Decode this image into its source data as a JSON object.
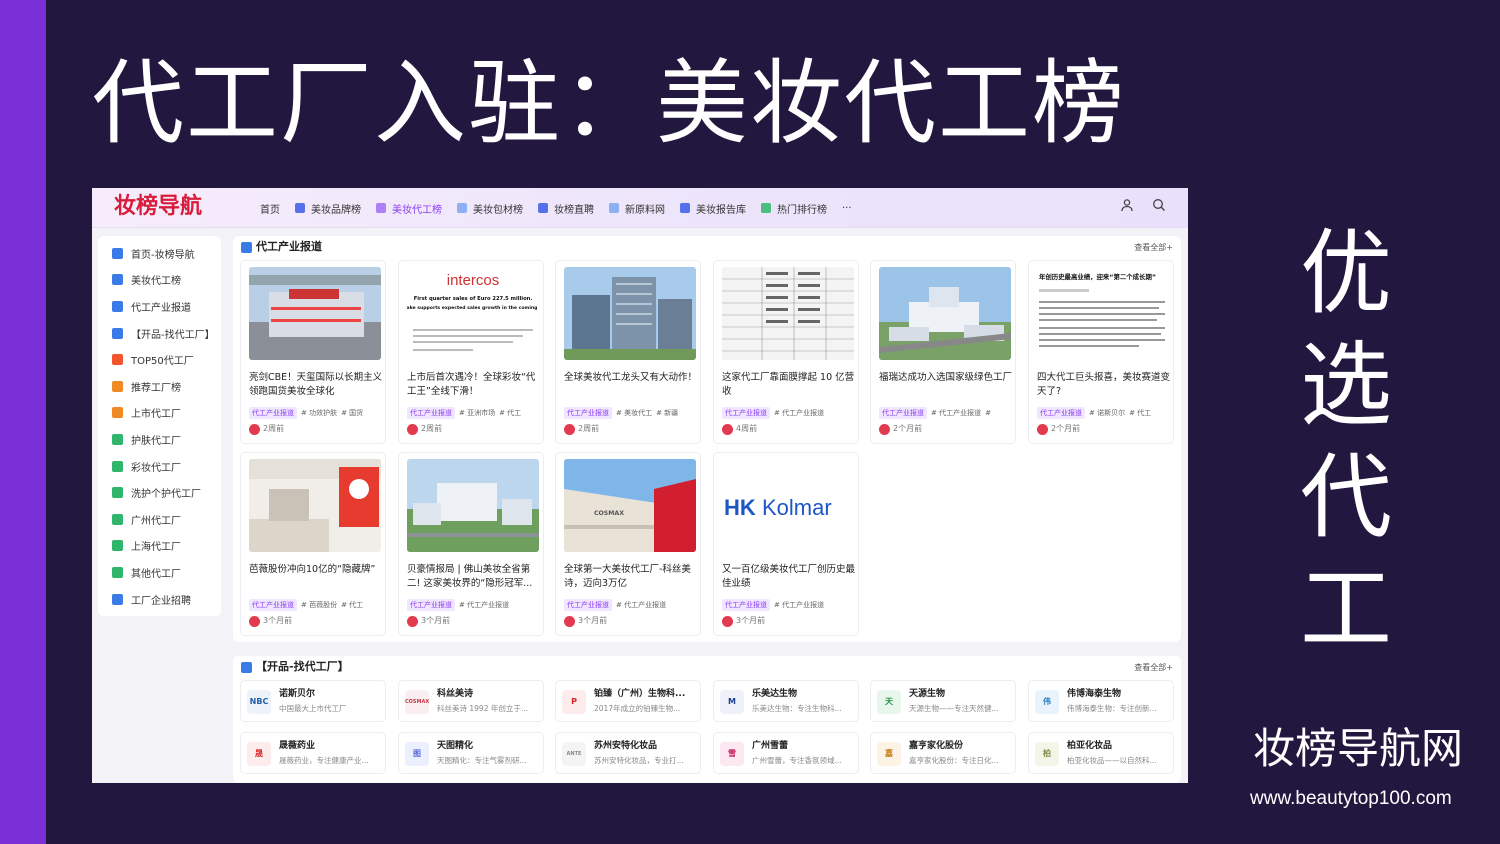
{
  "headline": "代工厂入驻：美妆代工榜",
  "vertical_text": [
    "优",
    "选",
    "代",
    "工"
  ],
  "brand": "妆榜导航网",
  "url": "www.beautytop100.com",
  "site": {
    "logo": "妆榜导航",
    "nav": [
      {
        "label": "首页",
        "icon": "none"
      },
      {
        "label": "美妆品牌榜",
        "icon": "bookmark-icon"
      },
      {
        "label": "美妆代工榜",
        "icon": "home-icon",
        "active": true
      },
      {
        "label": "美妆包材榜",
        "icon": "home-icon"
      },
      {
        "label": "妆榜直聘",
        "icon": "flag-icon"
      },
      {
        "label": "新原料网",
        "icon": "chat-icon"
      },
      {
        "label": "美妆报告库",
        "icon": "report-icon"
      },
      {
        "label": "热门排行榜",
        "icon": "bar-chart-icon"
      },
      {
        "label": "···",
        "icon": "none"
      }
    ],
    "sidebar": [
      {
        "label": "首页-妆榜导航",
        "icon": "home-icon",
        "color": "#3b7be8"
      },
      {
        "label": "美妆代工榜",
        "icon": "grid-icon",
        "color": "#3b7be8"
      },
      {
        "label": "代工产业报道",
        "icon": "news-icon",
        "color": "#3b7be8"
      },
      {
        "label": "【开品-找代工厂】",
        "icon": "grid-icon",
        "color": "#3b7be8"
      },
      {
        "label": "TOP50代工厂",
        "icon": "fire-icon",
        "color": "#f2542d"
      },
      {
        "label": "推荐工厂榜",
        "icon": "bookmark-icon",
        "color": "#f08a24"
      },
      {
        "label": "上市代工厂",
        "icon": "bookmark-icon",
        "color": "#f08a24"
      },
      {
        "label": "护肤代工厂",
        "icon": "apps-icon",
        "color": "#2fb66a"
      },
      {
        "label": "彩妆代工厂",
        "icon": "apps-icon",
        "color": "#2fb66a"
      },
      {
        "label": "洗护个护代工厂",
        "icon": "apps-icon",
        "color": "#2fb66a"
      },
      {
        "label": "广州代工厂",
        "icon": "apps-icon",
        "color": "#2fb66a"
      },
      {
        "label": "上海代工厂",
        "icon": "apps-icon",
        "color": "#2fb66a"
      },
      {
        "label": "其他代工厂",
        "icon": "apps-icon",
        "color": "#2fb66a"
      },
      {
        "label": "工厂企业招聘",
        "icon": "flag-icon",
        "color": "#3b7be8"
      }
    ],
    "news_section": {
      "title": "代工产业报道",
      "view_all": "查看全部+",
      "cards": [
        {
          "title": "亮剑CBE！天玺国际以长期主义领跑国货美妆全球化",
          "tags": [
            "代工产业报道",
            "# 功效护肤",
            "# 国货"
          ],
          "time": "2周前"
        },
        {
          "title": "上市后首次遇冷！全球彩妆“代工王”全线下滑！",
          "tags": [
            "代工产业报道",
            "# 亚洲市场",
            "# 代工"
          ],
          "time": "2周前"
        },
        {
          "title": "全球美妆代工龙头又有大动作！",
          "tags": [
            "代工产业报道",
            "# 美妆代工",
            "# 新疆"
          ],
          "time": "2周前"
        },
        {
          "title": "这家代工厂靠面膜撑起 10 亿营收",
          "tags": [
            "代工产业报道",
            "# 代工产业报道"
          ],
          "time": "4周前"
        },
        {
          "title": "福瑞达成功入选国家级绿色工厂",
          "tags": [
            "代工产业报道",
            "# 代工产业报道",
            "#"
          ],
          "time": "2个月前"
        },
        {
          "title": "四大代工巨头报喜，美妆赛道变天了?",
          "tags": [
            "代工产业报道",
            "# 诺斯贝尔",
            "# 代工"
          ],
          "time": "2个月前"
        },
        {
          "title": "芭薇股份冲向10亿的“隐藏牌”",
          "tags": [
            "代工产业报道",
            "# 芭薇股份",
            "# 代工"
          ],
          "time": "3个月前"
        },
        {
          "title": "贝豪情报局 | 佛山美妆全省第二! 这家美妆界的“隐形冠军...",
          "tags": [
            "代工产业报道",
            "# 代工产业报道"
          ],
          "time": "3个月前"
        },
        {
          "title": "全球第一大美妆代工厂-科丝美诗，迈向3万亿",
          "tags": [
            "代工产业报道",
            "# 代工产业报道"
          ],
          "time": "3个月前"
        },
        {
          "title": "又一百亿级美妆代工厂创历史最佳业绩",
          "tags": [
            "代工产业报道",
            "# 代工产业报道"
          ],
          "time": "3个月前"
        }
      ],
      "thumb_text": {
        "intercos": "intercos",
        "intercos_line1": "First quarter sales of Euro 227.5 million.",
        "intercos_line2": "Order intake supports expected sales growth in the coming quarters.",
        "report_head": "年创历史最高业绩，迎来“第二个成长期”",
        "kolmar": "Kolmar",
        "cosmax": "COSMAX"
      }
    },
    "factory_section": {
      "title": "【开品-找代工厂】",
      "view_all": "查看全部+",
      "factories": [
        {
          "name": "诺斯贝尔",
          "desc": "中国最大上市代工厂",
          "logo": "NBC",
          "color": "#1f5fa8",
          "bg": "#eef3fb"
        },
        {
          "name": "科丝美诗",
          "desc": "科丝美诗 1992 年创立于...",
          "logo": "COSMAX",
          "color": "#c23a4a",
          "bg": "#fbeef0"
        },
        {
          "name": "铂臻（广州）生物科...",
          "desc": "2017年成立的铂臻生物...",
          "logo": "P",
          "color": "#d8242c",
          "bg": "#fdecec"
        },
        {
          "name": "乐美达生物",
          "desc": "乐美达生物：专注生物科...",
          "logo": "M",
          "color": "#1e3f8a",
          "bg": "#eef1fa"
        },
        {
          "name": "天源生物",
          "desc": "天源生物——专注天然健...",
          "logo": "天",
          "color": "#1e8f3c",
          "bg": "#e9f6ec"
        },
        {
          "name": "伟博海泰生物",
          "desc": "伟博海泰生物：专注创新...",
          "logo": "伟",
          "color": "#2a7fc0",
          "bg": "#eaf3fb"
        },
        {
          "name": "晟薇药业",
          "desc": "晟薇药业，专注健康产业...",
          "logo": "晟",
          "color": "#d8242c",
          "bg": "#fdecec"
        },
        {
          "name": "天图精化",
          "desc": "天图精化：专注气雾剂研...",
          "logo": "图",
          "color": "#5a6fe0",
          "bg": "#eceffd"
        },
        {
          "name": "苏州安特化妆品",
          "desc": "苏州安特化妆品，专业打...",
          "logo": "ANTE",
          "color": "#888888",
          "bg": "#f4f4f4"
        },
        {
          "name": "广州雪蕾",
          "desc": "广州雪蕾，专注香氛领域...",
          "logo": "雪",
          "color": "#c2185b",
          "bg": "#fce8f0"
        },
        {
          "name": "嘉亨家化股份",
          "desc": "嘉亨家化股份：专注日化...",
          "logo": "嘉",
          "color": "#c27a10",
          "bg": "#fdf3e4"
        },
        {
          "name": "柏亚化妆品",
          "desc": "柏亚化妆品——以自然科...",
          "logo": "柏",
          "color": "#7a8a3a",
          "bg": "#f3f5e9"
        }
      ]
    }
  }
}
